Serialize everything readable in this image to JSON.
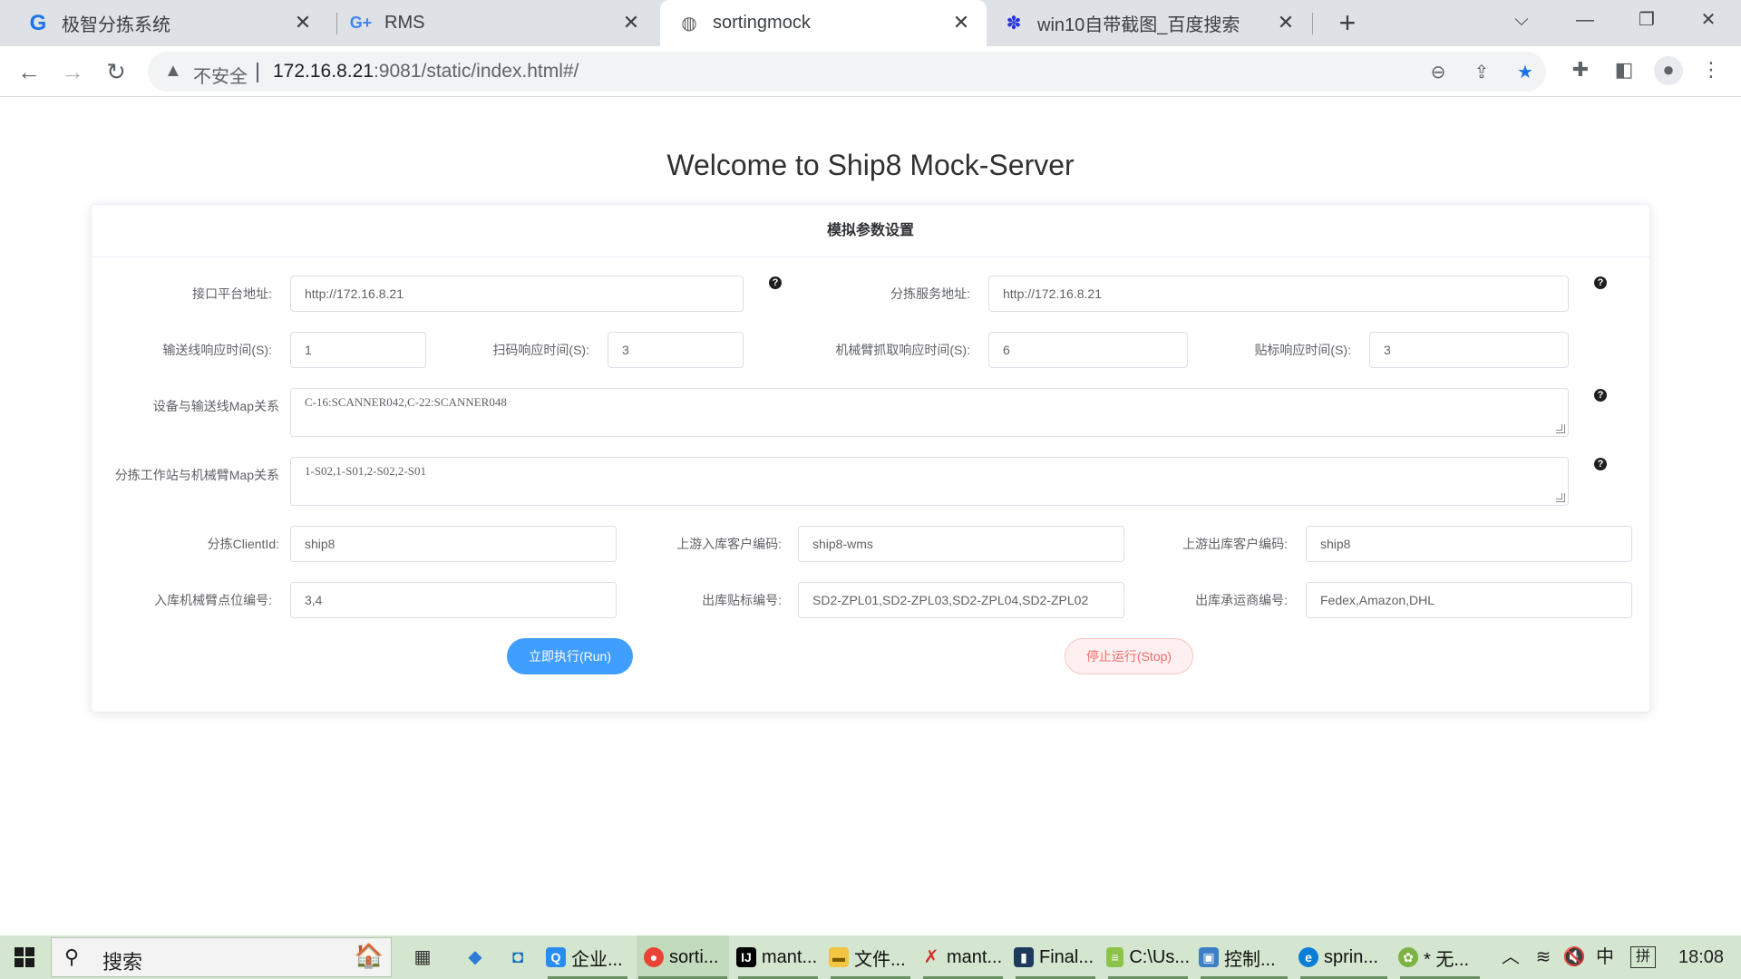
{
  "browser": {
    "tabs": [
      {
        "title": "极智分拣系统",
        "favicon": "g-logo-icon"
      },
      {
        "title": "RMS",
        "favicon": "g-plus-icon"
      },
      {
        "title": "sortingmock",
        "favicon": "globe-icon"
      },
      {
        "title": "win10自带截图_百度搜索",
        "favicon": "baidu-paw-icon"
      }
    ],
    "active_tab": 2,
    "security_label": "不安全",
    "url_host": "172.16.8.21",
    "url_rest": ":9081/static/index.html#/"
  },
  "page": {
    "title": "Welcome to Ship8 Mock-Server",
    "card_title": "模拟参数设置"
  },
  "form": {
    "api_addr": {
      "label": "接口平台地址:",
      "value": "http://172.16.8.21"
    },
    "sort_addr": {
      "label": "分拣服务地址:",
      "value": "http://172.16.8.21"
    },
    "conveyor_time": {
      "label": "输送线响应时间(S):",
      "value": "1"
    },
    "scan_time": {
      "label": "扫码响应时间(S):",
      "value": "3"
    },
    "arm_time": {
      "label": "机械臂抓取响应时间(S):",
      "value": "6"
    },
    "label_time": {
      "label": "贴标响应时间(S):",
      "value": "3"
    },
    "device_map": {
      "label": "设备与输送线Map关系",
      "value": "C-16:SCANNER042,C-22:SCANNER048"
    },
    "station_map": {
      "label": "分拣工作站与机械臂Map关系",
      "value": "1-S02,1-S01,2-S02,2-S01"
    },
    "client_id": {
      "label": "分拣ClientId:",
      "value": "ship8"
    },
    "inbound_customer": {
      "label": "上游入库客户编码:",
      "value": "ship8-wms"
    },
    "outbound_customer": {
      "label": "上游出库客户编码:",
      "value": "ship8"
    },
    "inbound_arm_points": {
      "label": "入库机械臂点位编号:",
      "value": "3,4"
    },
    "outbound_label_no": {
      "label": "出库贴标编号:",
      "value": "SD2-ZPL01,SD2-ZPL03,SD2-ZPL04,SD2-ZPL02"
    },
    "outbound_carrier": {
      "label": "出库承运商编号:",
      "value": "Fedex,Amazon,DHL"
    },
    "run_label": "立即执行(Run)",
    "stop_label": "停止运行(Stop)",
    "help_glyph": "?"
  },
  "taskbar": {
    "search_label": "搜索",
    "apps": [
      {
        "label": "企业...",
        "icon": "wecom-icon"
      },
      {
        "label": "sorti...",
        "icon": "chrome-icon"
      },
      {
        "label": "mant...",
        "icon": "intellij-icon"
      },
      {
        "label": "文件...",
        "icon": "folder-icon"
      },
      {
        "label": "mant...",
        "icon": "xmind-icon"
      },
      {
        "label": "Final...",
        "icon": "terminal-icon"
      },
      {
        "label": "C:\\Us...",
        "icon": "notepad-icon"
      },
      {
        "label": "控制...",
        "icon": "control-panel-icon"
      },
      {
        "label": "sprin...",
        "icon": "edge-icon"
      },
      {
        "label": "* 无...",
        "icon": "notepad-plus-icon"
      }
    ],
    "ime_lang": "中",
    "ime_mode": "拼",
    "clock": "18:08"
  },
  "colors": {
    "primary": "#409eff",
    "danger": "#f56c6c",
    "taskbar": "#d4e6cf"
  }
}
